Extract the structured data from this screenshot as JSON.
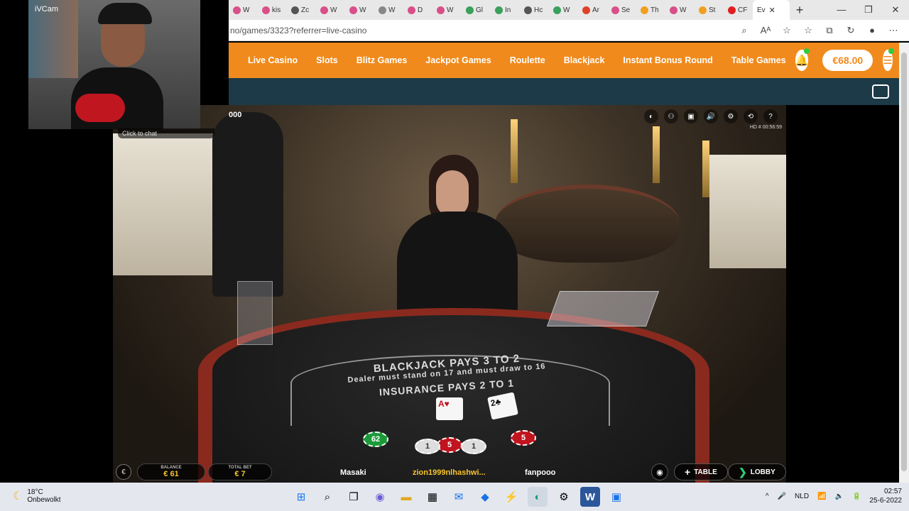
{
  "browser": {
    "tabs": [
      {
        "label": "W",
        "color": "#d94f8a"
      },
      {
        "label": "kis",
        "color": "#d94f8a"
      },
      {
        "label": "Zc",
        "color": "#555555"
      },
      {
        "label": "W",
        "color": "#d94f8a"
      },
      {
        "label": "W",
        "color": "#d94f8a"
      },
      {
        "label": "W",
        "color": "#888888"
      },
      {
        "label": "D",
        "color": "#d94f8a"
      },
      {
        "label": "W",
        "color": "#d94f8a"
      },
      {
        "label": "Gl",
        "color": "#3aa05a"
      },
      {
        "label": "In",
        "color": "#3aa05a"
      },
      {
        "label": "Hc",
        "color": "#555555"
      },
      {
        "label": "W",
        "color": "#3aa05a"
      },
      {
        "label": "Ar",
        "color": "#e0402a"
      },
      {
        "label": "Se",
        "color": "#d94f8a"
      },
      {
        "label": "Th",
        "color": "#f0a020"
      },
      {
        "label": "W",
        "color": "#d94f8a"
      },
      {
        "label": "St",
        "color": "#f0a020"
      },
      {
        "label": "CF",
        "color": "#e02020"
      }
    ],
    "active_tab": "Ev",
    "new_tab": "+",
    "window_controls": [
      "—",
      "❐",
      "✕"
    ],
    "url": "no/games/3323?referrer=live-casino",
    "address_icons": [
      "⌕",
      "Aᴬ",
      "☆",
      "☆",
      "⧉",
      "↻",
      "●",
      "⋯"
    ]
  },
  "site_nav": {
    "items": [
      "Live Casino",
      "Slots",
      "Blitz Games",
      "Jackpot Games",
      "Roulette",
      "Blackjack",
      "Instant Bonus Round",
      "Table Games"
    ],
    "balance": "€68.00",
    "bell_icon": "🔔",
    "menu_icon": "☰"
  },
  "game": {
    "counter": "000",
    "table_text": {
      "line1": "BLACKJACK PAYS 3 TO 2",
      "line2": "Dealer must stand on 17 and must draw to 16",
      "line3": "INSURANCE PAYS 2 TO 1"
    },
    "cards": [
      {
        "rank": "A",
        "suit": "♥"
      },
      {
        "rank": "2",
        "suit": "♣"
      }
    ],
    "chips": [
      "62",
      "5",
      "1",
      "1",
      "5"
    ],
    "hd_label": "HD",
    "timer": "# 00:56:59",
    "controls": [
      "◐",
      "⚇",
      "▣",
      "🔊",
      "⚙",
      "⟲",
      "?"
    ]
  },
  "bottom_bar": {
    "currency_icon": "€",
    "balance_label": "BALANCE",
    "balance_value": "€ 61",
    "total_bet_label": "TOTAL BET",
    "total_bet_value": "€ 7",
    "players": [
      "Masaki",
      "zion1999nlhashwi...",
      "fanpooo"
    ],
    "table_button": "TABLE",
    "lobby_button": "LOBBY"
  },
  "webcam": {
    "label": "iVCam",
    "chat_hint": "Click to chat"
  },
  "taskbar": {
    "temperature": "18°C",
    "weather": "Onbewolkt",
    "apps": [
      "⊞",
      "⌕",
      "❐",
      "◉",
      "▬",
      "▦",
      "✉",
      "◆",
      "⚡",
      "◐",
      "⚙",
      "W",
      "▣"
    ],
    "language": "NLD",
    "time": "02:57",
    "date": "25-6-2022",
    "tray_icons": [
      "^",
      "🎤",
      "📶",
      "🔈",
      "🔋"
    ]
  }
}
